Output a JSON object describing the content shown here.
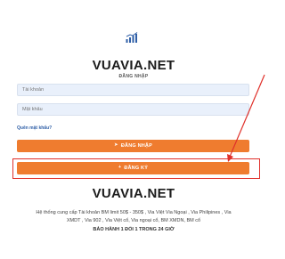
{
  "colors": {
    "accent": "#ef7c2f",
    "brand_icon": "#2f5fa7",
    "link": "#2f5fa7",
    "highlight": "#e0302a",
    "input_bg": "#e9f0fb"
  },
  "logo": {
    "icon": "bar-chart-icon"
  },
  "brand_top": "VUAVIA.NET",
  "subtitle": "ĐĂNG NHẬP",
  "login_form": {
    "username_placeholder": "Tài khoản",
    "password_placeholder": "Mật khẩu",
    "forgot_label": "Quên mật khẩu?",
    "login_button_label": "ĐĂNG NHẬP",
    "login_button_icon": "sign-in-icon",
    "register_button_label": "ĐĂNG KÝ",
    "register_button_icon": "plus-icon"
  },
  "brand_bottom": "VUAVIA.NET",
  "description": {
    "line1": "Hệ thống cung cấp Tài khoản BM limit 50$ - 350$ , Via Việt Via Ngoại , Via Philipines , Via",
    "line2": "XMDT , Via 902 , Via Việt cổ, Via ngoại cổ, BM XMDN, BM cổ",
    "line3": "BẢO HÀNH 1 ĐỔI 1 TRONG 24 GIỜ"
  }
}
